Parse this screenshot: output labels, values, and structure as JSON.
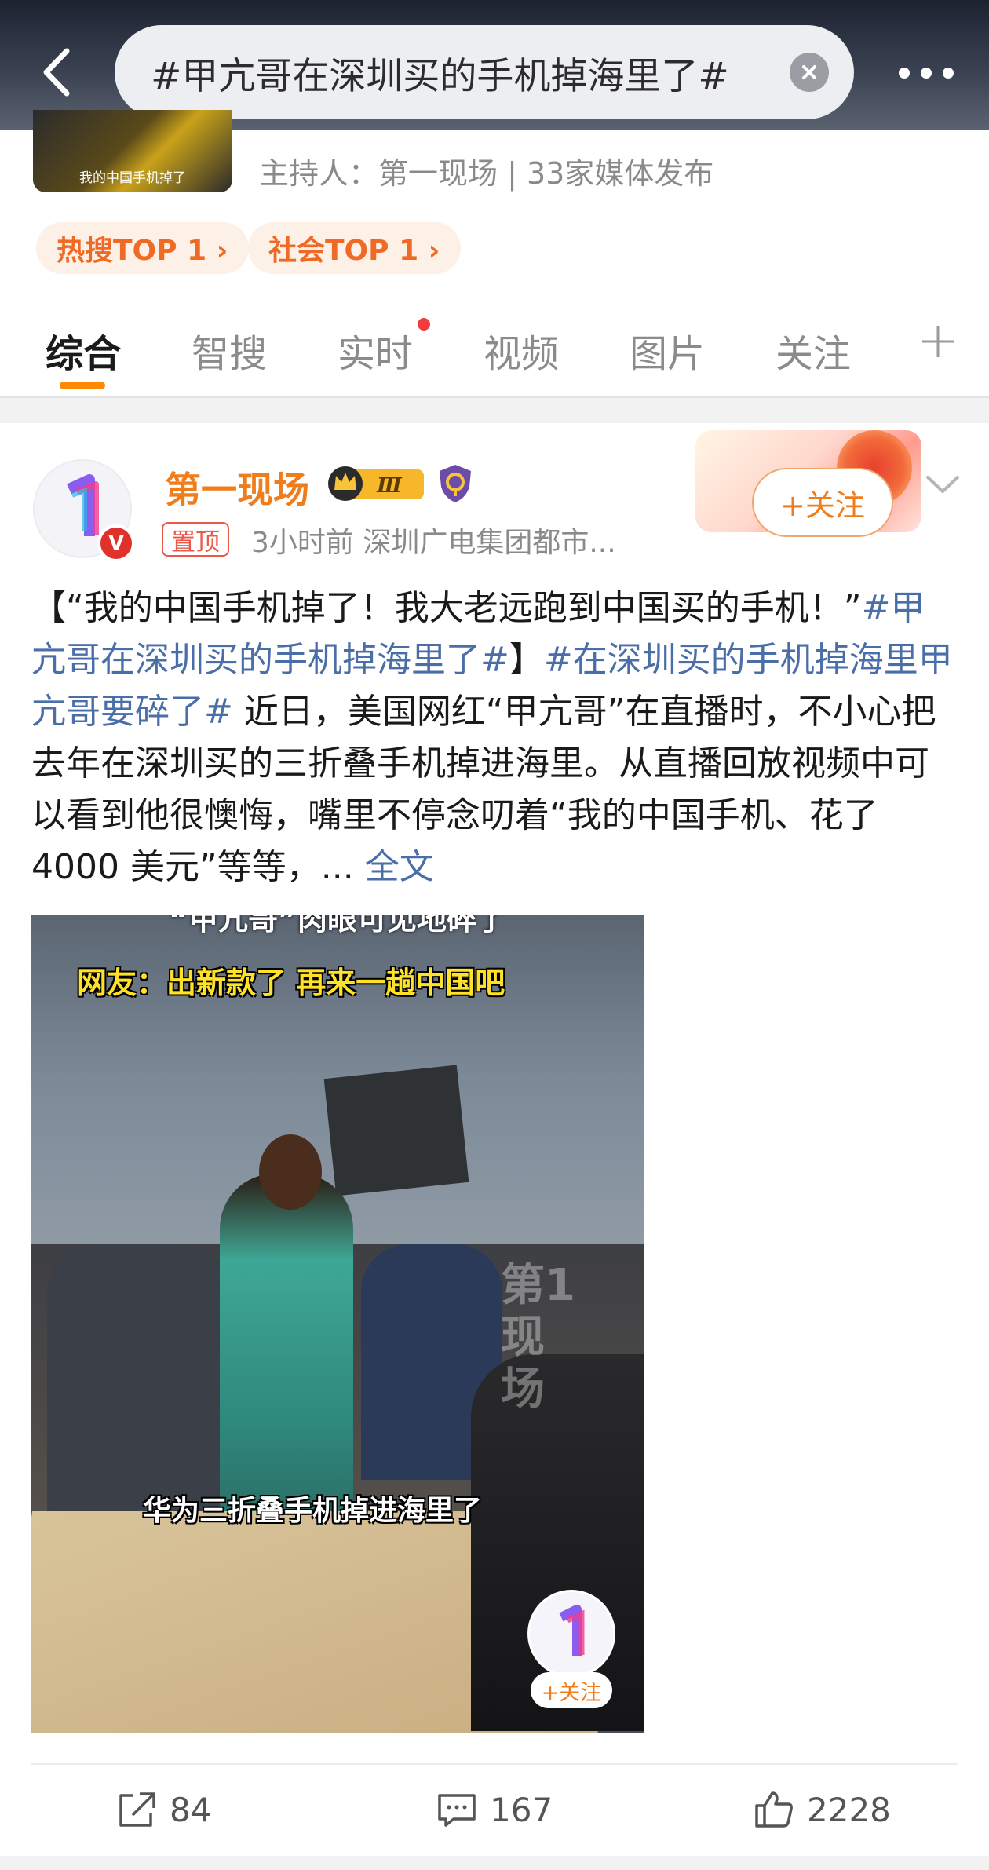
{
  "header": {
    "search_text": "#甲亢哥在深圳买的手机掉海里了#",
    "back_icon": "chevron-left-icon",
    "clear_icon": "clear-icon",
    "more_icon": "more-icon"
  },
  "topic": {
    "thumb_caption": "我的中国手机掉了",
    "host_line": "主持人：第一现场 | 33家媒体发布",
    "badges": [
      "热搜TOP 1 ›",
      "社会TOP 1 ›"
    ]
  },
  "tabs": {
    "items": [
      "综合",
      "智搜",
      "实时",
      "视频",
      "图片",
      "关注"
    ],
    "active": "综合",
    "plus_icon": "plus-icon"
  },
  "post": {
    "username": "第一现场",
    "level_badge": "Ⅲ",
    "pinned_label": "置顶",
    "meta": "3小时前  深圳广电集团都市...",
    "follow_label": "+关注",
    "verified_mark": "V",
    "text_intro": "【“我的中国手机掉了！我大老远跑到中国买的手机！”",
    "tag1": "#甲亢哥在深圳买的手机掉海里了#",
    "bracket_close": "】",
    "tag2": "#在深圳买的手机掉海里甲亢哥要碎了#",
    "text_body": " 近日，美国网红“甲亢哥”在直播时，不小心把去年在深圳买的三折叠手机掉进海里。从直播回放视频中可以看到他很懊悔，嘴里不停念叨着“我的中国手机、花了 4000 美元”等等，... ",
    "full_text_link": "全文",
    "video": {
      "top_caption": "“甲亢哥”肉眼可见地碎了",
      "yellow_caption": "网友：出新款了 再来一趟中国吧",
      "subtitle": "华为三折叠手机掉进海里了",
      "watermark": "第1现场",
      "follow_label": "+关注"
    },
    "actions": {
      "reposts": "84",
      "comments": "167",
      "likes": "2228"
    }
  },
  "colors": {
    "accent_orange": "#f07d1b",
    "tag_blue": "#4a6ea8",
    "tab_underline": "#ff8a00",
    "pin_red": "#e8594a"
  }
}
